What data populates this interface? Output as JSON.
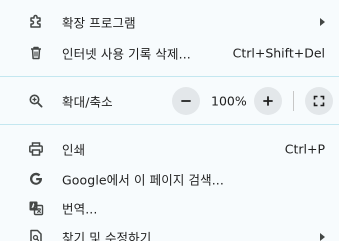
{
  "menu": {
    "extensions": {
      "label": "확장 프로그램",
      "icon": "puzzle-icon"
    },
    "clear_history": {
      "label": "인터넷 사용 기록 삭제...",
      "shortcut": "Ctrl+Shift+Del",
      "icon": "trash-icon"
    },
    "zoom": {
      "label": "확대/축소",
      "value": "100%",
      "icon": "zoom-icon",
      "minus_icon": "minus-icon",
      "plus_icon": "plus-icon",
      "fullscreen_icon": "fullscreen-icon"
    },
    "print": {
      "label": "인쇄",
      "shortcut": "Ctrl+P",
      "icon": "printer-icon"
    },
    "search_page": {
      "label": "Google에서 이 페이지 검색...",
      "icon": "google-icon"
    },
    "translate": {
      "label": "번역...",
      "icon": "translate-icon"
    },
    "find_edit": {
      "label": "찾기 및 수정하기",
      "icon": "find-icon"
    }
  },
  "colors": {
    "menu_background": "#f7fbfd",
    "divider": "#c4e7f0",
    "text": "#1f1f1f",
    "icon": "#444746",
    "button_background": "#e3e7ea"
  }
}
